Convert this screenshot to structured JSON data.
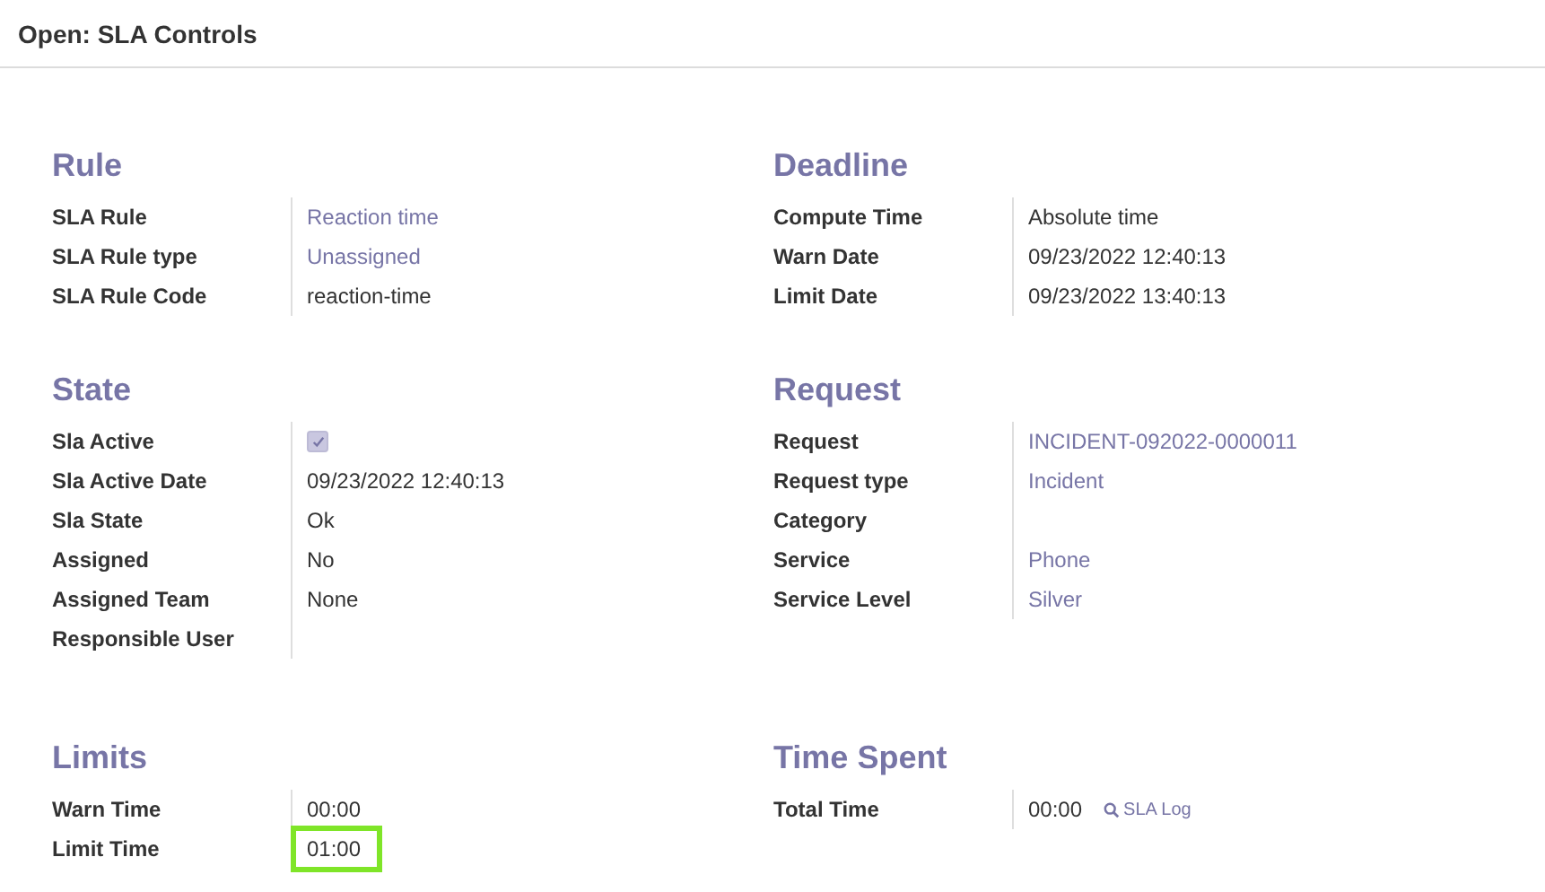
{
  "window": {
    "title": "Open: SLA Controls"
  },
  "section_rows": [
    [
      {
        "title": "Rule",
        "fields": [
          {
            "label": "SLA Rule",
            "value": "Reaction time",
            "kind": "link"
          },
          {
            "label": "SLA Rule type",
            "value": "Unassigned",
            "kind": "link"
          },
          {
            "label": "SLA Rule Code",
            "value": "reaction-time",
            "kind": "text"
          }
        ]
      },
      {
        "title": "Deadline",
        "fields": [
          {
            "label": "Compute Time",
            "value": "Absolute time",
            "kind": "text"
          },
          {
            "label": "Warn Date",
            "value": "09/23/2022 12:40:13",
            "kind": "text"
          },
          {
            "label": "Limit Date",
            "value": "09/23/2022 13:40:13",
            "kind": "text"
          }
        ]
      }
    ],
    [
      {
        "title": "State",
        "fields": [
          {
            "label": "Sla Active",
            "kind": "checkbox",
            "checked": true
          },
          {
            "label": "Sla Active Date",
            "value": "09/23/2022 12:40:13",
            "kind": "text"
          },
          {
            "label": "Sla State",
            "value": "Ok",
            "kind": "text"
          },
          {
            "label": "Assigned",
            "value": "No",
            "kind": "text"
          },
          {
            "label": "Assigned Team",
            "value": "None",
            "kind": "text"
          },
          {
            "label": "Responsible User",
            "kind": "text"
          }
        ]
      },
      {
        "title": "Request",
        "fields": [
          {
            "label": "Request",
            "value": "INCIDENT-092022-0000011",
            "kind": "link"
          },
          {
            "label": "Request type",
            "value": "Incident",
            "kind": "link"
          },
          {
            "label": "Category",
            "kind": "text"
          },
          {
            "label": "Service",
            "value": "Phone",
            "kind": "link"
          },
          {
            "label": "Service Level",
            "value": "Silver",
            "kind": "link"
          }
        ]
      }
    ],
    [
      {
        "title": "Limits",
        "fields": [
          {
            "label": "Warn Time",
            "value": "00:00",
            "kind": "text",
            "highlighted": false
          },
          {
            "label": "Limit Time",
            "value": "01:00",
            "kind": "text",
            "highlighted": true
          }
        ]
      },
      {
        "title": "Time Spent",
        "fields": [
          {
            "label": "Total Time",
            "value": "00:00",
            "kind": "text",
            "action": "SLA Log"
          }
        ]
      }
    ]
  ]
}
